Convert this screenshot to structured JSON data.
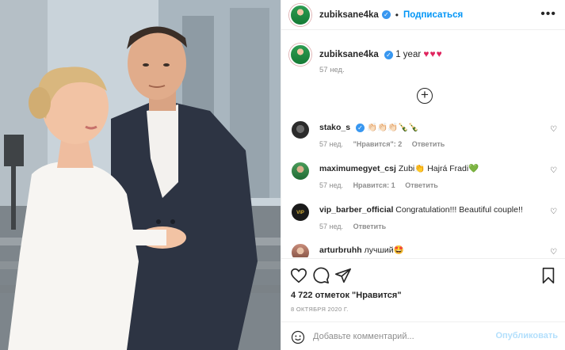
{
  "post": {
    "author": "zubiksane4ka",
    "follow_label": "Подписаться",
    "dot": "•",
    "more_icon": "•••",
    "caption": {
      "username": "zubiksane4ka",
      "text": "1 year",
      "hearts": "♥♥♥",
      "time": "57 нед."
    },
    "load_more_icon": "+",
    "comments": [
      {
        "username": "stako_s",
        "text": "👏🏻👏🏻👏🏻🍾🍾",
        "time": "57 нед.",
        "likes": "\"Нравится\": 2",
        "reply": "Ответить",
        "avatar": "av-stako"
      },
      {
        "username": "maximumegyet_csj",
        "text": "Zubi👏 Hajrá Fradi💚",
        "time": "57 нед.",
        "likes": "Нравится: 1",
        "reply": "Ответить",
        "avatar": "av-max"
      },
      {
        "username": "vip_barber_official",
        "text": "Congratulation!!! Beautiful couple!!",
        "time": "57 нед.",
        "likes": "",
        "reply": "Ответить",
        "avatar": "av-vip",
        "avatar_text": "VIP"
      },
      {
        "username": "arturbruhh",
        "text": "лучший🤩",
        "time": "",
        "likes": "",
        "reply": "",
        "avatar": "av-art"
      }
    ],
    "likes_text": "4 722 отметок \"Нравится\"",
    "date": "8 ОКТЯБРЯ 2020 Г.",
    "comment_placeholder": "Добавьте комментарий...",
    "publish_label": "Опубликовать",
    "heart_outline": "♡",
    "colors": {
      "link": "#0095f6",
      "verified": "#3897f0",
      "muted": "#8e8e8e",
      "publish_disabled": "#b2dffc"
    }
  }
}
